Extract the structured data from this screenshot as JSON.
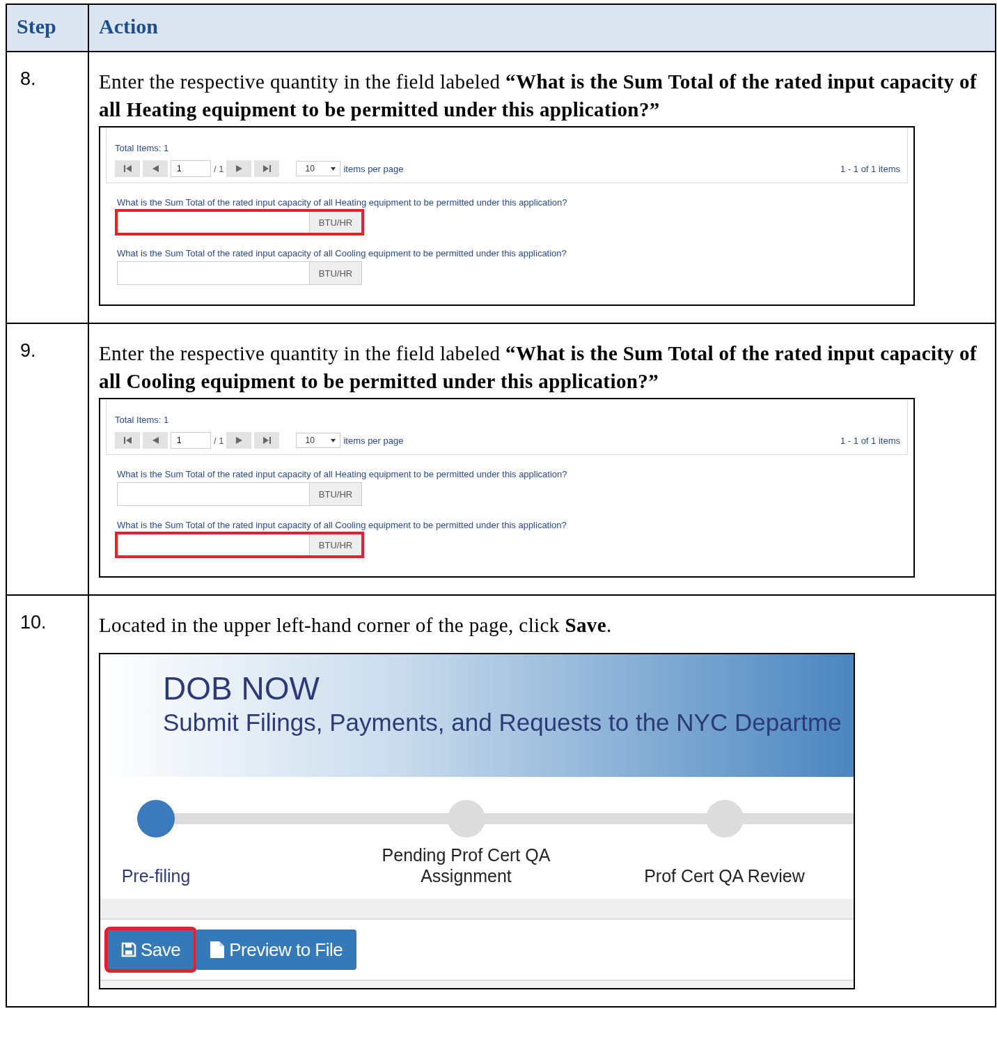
{
  "table": {
    "columns": [
      "Step",
      "Action"
    ],
    "rows": [
      {
        "step": "8.",
        "kind": "form",
        "instruction": "Enter the respective quantity in the field labeled **“What is the Sum Total of the rated input capacity of all Heating equipment to be permitted under this application?”**",
        "form": {
          "total_items": "Total Items: 1",
          "page": "1",
          "page_count": "/ 1",
          "page_size": "10",
          "per_page_label": "items per page",
          "range": "1 - 1 of 1 items",
          "questions": [
            {
              "label": "What is the Sum Total of the rated input capacity of all Heating equipment to be permitted under this application?",
              "unit": "BTU/HR",
              "highlighted": true
            },
            {
              "label": "What is the Sum Total of the rated input capacity of all Cooling equipment to be permitted under this application?",
              "unit": "BTU/HR",
              "highlighted": false
            }
          ]
        }
      },
      {
        "step": "9.",
        "kind": "form",
        "instruction": "Enter the respective quantity in the field labeled **“What is the Sum Total of the rated input capacity of all Cooling equipment to be permitted under this application?”**",
        "form": {
          "total_items": "Total Items: 1",
          "page": "1",
          "page_count": "/ 1",
          "page_size": "10",
          "per_page_label": "items per page",
          "range": "1 - 1 of 1 items",
          "questions": [
            {
              "label": "What is the Sum Total of the rated input capacity of all Heating equipment to be permitted under this application?",
              "unit": "BTU/HR",
              "highlighted": false
            },
            {
              "label": "What is the Sum Total of the rated input capacity of all Cooling equipment to be permitted under this application?",
              "unit": "BTU/HR",
              "highlighted": true
            }
          ]
        }
      },
      {
        "step": "10.",
        "kind": "app",
        "instruction": "Located in the upper left-hand corner of the page, click **Save**.",
        "app": {
          "title": "DOB NOW",
          "subtitle": "Submit Filings, Payments, and Requests to the NYC Departme",
          "steps": [
            {
              "label": "Pre-filing",
              "selected": true
            },
            {
              "label": "Pending Prof Cert QA Assignment",
              "selected": false
            },
            {
              "label": "Prof Cert QA Review",
              "selected": false
            }
          ],
          "buttons": [
            {
              "label": "Save",
              "kind": "save",
              "highlighted": true
            },
            {
              "label": "Preview to File",
              "kind": "preview",
              "highlighted": false
            }
          ]
        }
      }
    ]
  }
}
